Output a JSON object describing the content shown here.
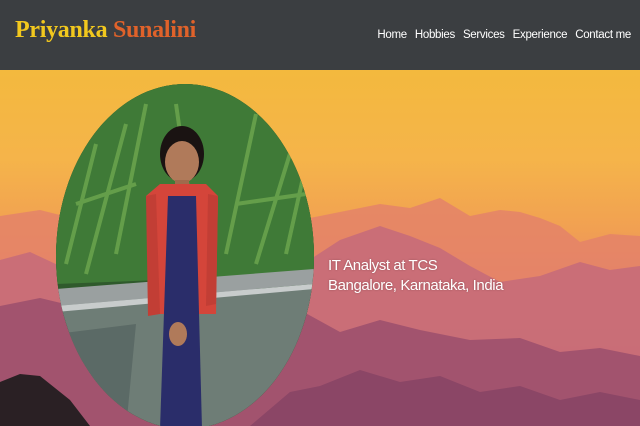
{
  "brand": {
    "first": "Priyanka",
    "last": "Sunalini"
  },
  "nav": {
    "items": [
      {
        "label": "Home"
      },
      {
        "label": "Hobbies"
      },
      {
        "label": "Services"
      },
      {
        "label": "Experience"
      },
      {
        "label": "Contact me"
      }
    ]
  },
  "hero": {
    "job_title": "IT Analyst at TCS",
    "location": "Bangalore, Karnataka, India"
  },
  "colors": {
    "navbar_bg": "#3b3e41",
    "brand_first": "#f2c81e",
    "brand_last": "#e0622a",
    "nav_text": "#ffffff"
  }
}
